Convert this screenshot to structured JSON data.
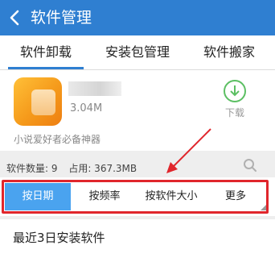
{
  "header": {
    "title": "软件管理"
  },
  "tabs": [
    {
      "label": "软件卸载"
    },
    {
      "label": "安装包管理"
    },
    {
      "label": "软件搬家"
    }
  ],
  "app": {
    "size": "3.04M",
    "download_label": "下载",
    "description": "小说爱好者必备神器"
  },
  "stats": {
    "count_label": "软件数量: 9",
    "usage_label": "占用: 367.3MB"
  },
  "sort_options": [
    {
      "label": "按日期"
    },
    {
      "label": "按频率"
    },
    {
      "label": "按软件大小"
    },
    {
      "label": "更多"
    }
  ],
  "section": {
    "title": "最近3日安装软件"
  },
  "colors": {
    "header": "#2f7fd1",
    "active_sort": "#4aa3ef",
    "highlight": "#e0262c",
    "download": "#5cbf63"
  }
}
